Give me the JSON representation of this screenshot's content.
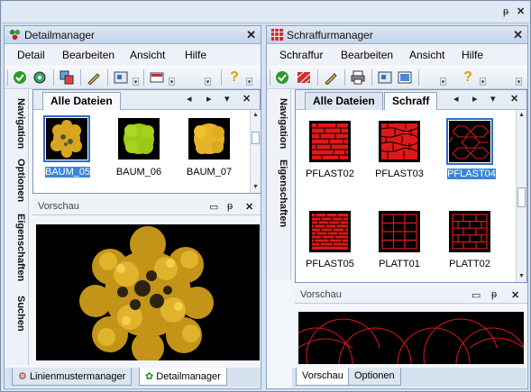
{
  "window": {
    "pin": "ᵽ",
    "close": "✕"
  },
  "left": {
    "title": "Detailmanager",
    "close": "✕",
    "menu": [
      "Detail",
      "Bearbeiten",
      "Ansicht",
      "Hilfe"
    ],
    "side_tabs": [
      "Navigation",
      "Optionen",
      "Eigenschaften",
      "Suchen"
    ],
    "tab": "Alle Dateien",
    "nav": [
      "◂",
      "▸",
      "▾",
      "✕"
    ],
    "items": [
      {
        "label": "BAUM_05",
        "selected": true
      },
      {
        "label": "BAUM_06",
        "selected": false
      },
      {
        "label": "BAUM_07",
        "selected": false
      }
    ],
    "preview_title": "Vorschau",
    "preview_buttons": [
      "▭",
      "ᵽ",
      "✕"
    ],
    "bottom_tabs": [
      "Linienmustermanager",
      "Detailmanager"
    ]
  },
  "right": {
    "title": "Schraffurmanager",
    "close": "✕",
    "menu": [
      "Schraffur",
      "Bearbeiten",
      "Ansicht",
      "Hilfe"
    ],
    "side_tabs": [
      "Navigation",
      "Eigenschaften"
    ],
    "tabs": [
      "Alle Dateien",
      "Schraff"
    ],
    "nav": [
      "◂",
      "▸",
      "▾",
      "✕"
    ],
    "items": [
      {
        "label": "PFLAST02",
        "selected": false
      },
      {
        "label": "PFLAST03",
        "selected": false
      },
      {
        "label": "PFLAST04",
        "selected": true
      },
      {
        "label": "PFLAST05",
        "selected": false
      },
      {
        "label": "PLATT01",
        "selected": false
      },
      {
        "label": "PLATT02",
        "selected": false
      }
    ],
    "preview_title": "Vorschau",
    "preview_buttons": [
      "▭",
      "ᵽ",
      "✕"
    ],
    "bottom_tabs": [
      "Vorschau",
      "Optionen"
    ]
  },
  "colors": {
    "accent": "#3a86d6",
    "hatch": "#ff2020",
    "tree": "#e0b020"
  }
}
